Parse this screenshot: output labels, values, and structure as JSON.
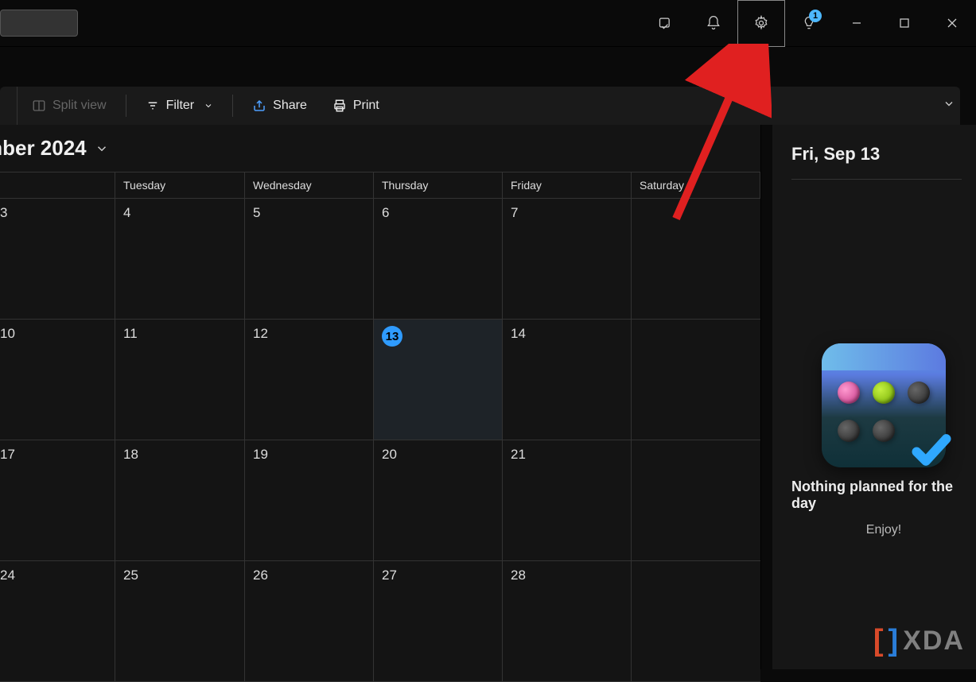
{
  "titlebar": {
    "badge_count": "1"
  },
  "toolbar": {
    "split_view_label": "Split view",
    "filter_label": "Filter",
    "share_label": "Share",
    "print_label": "Print"
  },
  "calendar": {
    "title": "mber 2024",
    "day_names": [
      "Tuesday",
      "Wednesday",
      "Thursday",
      "Friday",
      "Saturday"
    ],
    "today": "13",
    "weeks": [
      [
        "3",
        "4",
        "5",
        "6",
        "7"
      ],
      [
        "10",
        "11",
        "12",
        "13",
        "14"
      ],
      [
        "17",
        "18",
        "19",
        "20",
        "21"
      ],
      [
        "24",
        "25",
        "26",
        "27",
        "28"
      ]
    ]
  },
  "side": {
    "date_label": "Fri, Sep 13",
    "empty_title": "Nothing planned for the day",
    "empty_sub": "Enjoy!"
  },
  "watermark": "XDA"
}
